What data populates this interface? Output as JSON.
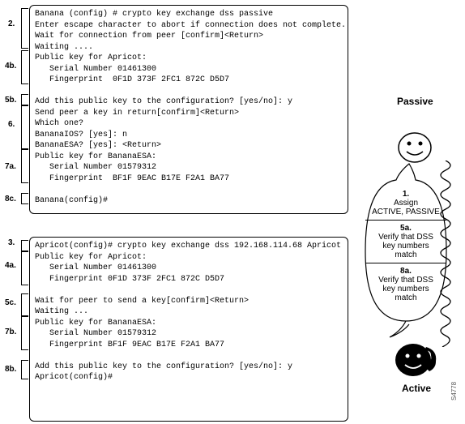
{
  "labels": {
    "l2": "2.",
    "l4b": "4b.",
    "l5b": "5b.",
    "l6": "6.",
    "l7a": "7a.",
    "l8c": "8c.",
    "l3": "3.",
    "l4a": "4a.",
    "l5c": "5c.",
    "l7b": "7b.",
    "l8b": "8b.",
    "passive": "Passive",
    "active": "Active"
  },
  "termA": {
    "l1": "Banana (config) # crypto key exchange dss passive",
    "l2": "Enter escape character to abort if connection does not complete.",
    "l3": "Wait for connection from peer [confirm]<Return>",
    "l4": "Waiting ....",
    "l5": "Public key for Apricot:",
    "l6": "   Serial Number 01461300",
    "l7": "   Fingerprint  0F1D 373F 2FC1 872C D5D7",
    "l8": " ",
    "l9": "Add this public key to the configuration? [yes/no]: y",
    "l10": "Send peer a key in return[confirm]<Return>",
    "l11": "Which one?",
    "l12": "BananaIOS? [yes]: n",
    "l13": "BananaESA? [yes]: <Return>",
    "l14": "Public key for BananaESA:",
    "l15": "   Serial Number 01579312",
    "l16": "   Fingerprint  BF1F 9EAC B17E F2A1 BA77",
    "l17": " ",
    "l18": "Banana(config)#"
  },
  "termB": {
    "l1": "Apricot(config)# crypto key exchange dss 192.168.114.68 Apricot",
    "l2": "Public key for Apricot:",
    "l3": "   Serial Number 01461300",
    "l4": "   Fingerprint 0F1D 373F 2FC1 872C D5D7",
    "l5": " ",
    "l6": "Wait for peer to send a key[confirm]<Return>",
    "l7": "Waiting ...",
    "l8": "Public key for BananaESA:",
    "l9": "   Serial Number 01579312",
    "l10": "   Fingerprint BF1F 9EAC B17E F2A1 BA77",
    "l11": " ",
    "l12": "Add this public key to the configuration? [yes/no]: y",
    "l13": "Apricot(config)#"
  },
  "bubble": {
    "s1a": "1.",
    "s1b": "Assign",
    "s1c": "ACTIVE, PASSIVE",
    "s5a": "5a.",
    "s5b": "Verify that DSS",
    "s5c": "key numbers",
    "s5d": "match",
    "s8a": "8a.",
    "s8b": "Verify that DSS",
    "s8c": "key numbers",
    "s8d": "match"
  },
  "figno": "S4778"
}
